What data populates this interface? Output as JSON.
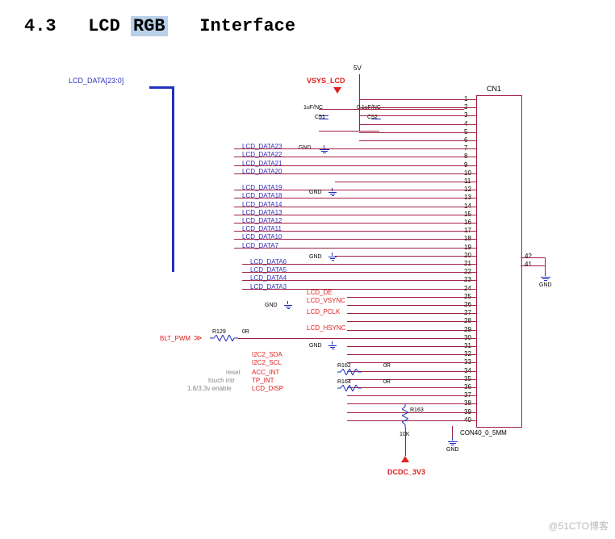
{
  "title": {
    "section": "4.3",
    "word1": "LCD",
    "highlight": "RGB",
    "word2": "Interface"
  },
  "power": {
    "v5": "5V",
    "vsys": "VSYS_LCD",
    "dcdc": "DCDC_3V3"
  },
  "bus": {
    "name": "LCD_DATA[23:0]"
  },
  "caps": {
    "c51": {
      "ref": "C51",
      "val": "1uF/NC"
    },
    "c52": {
      "ref": "C52",
      "val": "0.1uF/NC"
    }
  },
  "gnd_label": "GND",
  "connector": {
    "ref": "CN1",
    "type": "CON40_0_5MM"
  },
  "data_lines_top": [
    "LCD_DATA23",
    "LCD_DATA22",
    "LCD_DATA21",
    "LCD_DATA20"
  ],
  "data_lines_mid": [
    "LCD_DATA19",
    "LCD_DATA18",
    "LCD_DATA14",
    "LCD_DATA13",
    "LCD_DATA12",
    "LCD_DATA11",
    "LCD_DATA10",
    "LCD_DATA7"
  ],
  "data_lines_bot": [
    "LCD_DATA6",
    "LCD_DATA5",
    "LCD_DATA4",
    "LCD_DATA3"
  ],
  "ctrl": {
    "de": "LCD_DE",
    "vsync": "LCD_VSYNC",
    "pclk": "LCD_PCLK",
    "hsync": "LCD_HSYNC",
    "sda": "I2C2_SDA",
    "scl": "I2C2_SCL",
    "acc": "ACC_INT",
    "tp": "TP_INT",
    "disp": "LCD_DISP",
    "blt": "BLT_PWM"
  },
  "resistors": {
    "r129": {
      "ref": "R129",
      "val": "0R"
    },
    "r162": {
      "ref": "R162",
      "val": "0R"
    },
    "r164": {
      "ref": "R164",
      "val": "0R"
    },
    "r163": {
      "ref": "R163",
      "val": "10K"
    }
  },
  "notes": {
    "reset": "reset",
    "touch": "touch intr",
    "enable": "1.8/3.3v enable"
  },
  "pins_left": [
    "1",
    "2",
    "3",
    "4",
    "5",
    "6",
    "7",
    "8",
    "9",
    "10",
    "11",
    "12",
    "13",
    "14",
    "15",
    "16",
    "17",
    "18",
    "19",
    "20",
    "21",
    "22",
    "23",
    "24",
    "25",
    "26",
    "27",
    "28",
    "29",
    "30",
    "31",
    "32",
    "33",
    "34",
    "35",
    "36",
    "37",
    "38",
    "39",
    "40"
  ],
  "pins_right": [
    "42",
    "41"
  ],
  "watermark": "@51CTO博客"
}
